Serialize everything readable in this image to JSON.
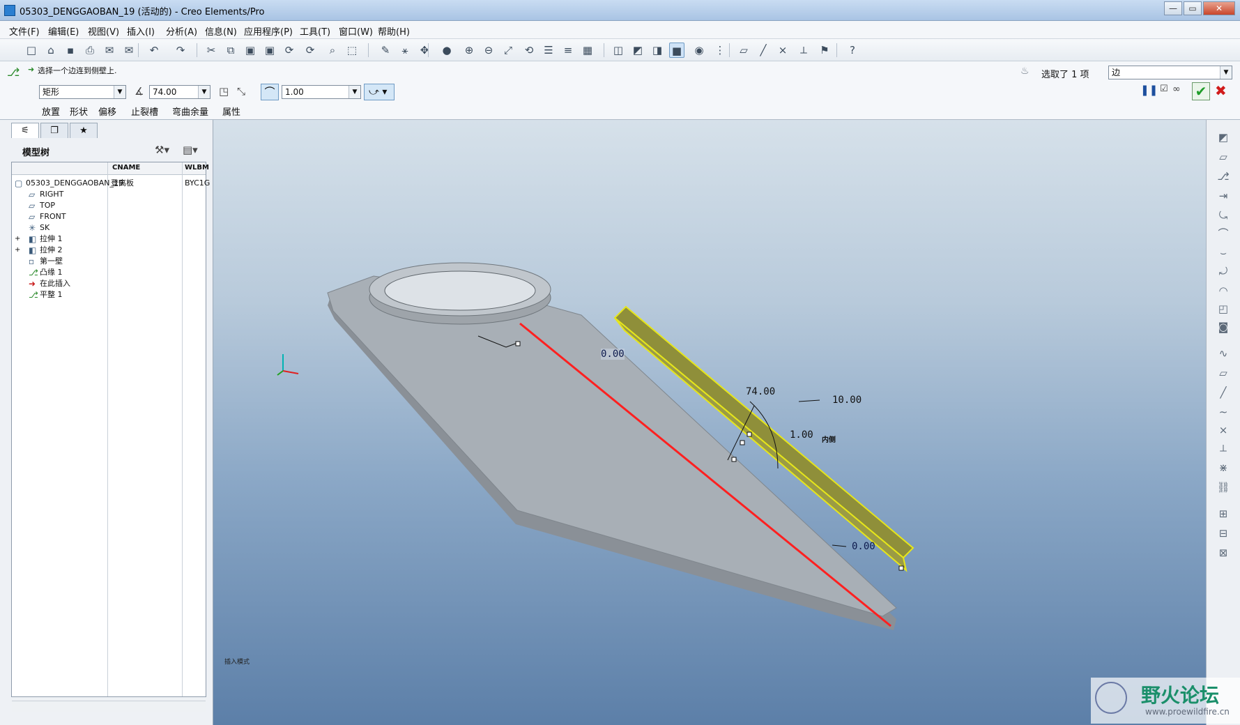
{
  "window": {
    "title": "05303_DENGGAOBAN_19 (活动的) - Creo Elements/Pro",
    "controls": [
      "—",
      "▭",
      "✕"
    ]
  },
  "menu": [
    "文件(F)",
    "编辑(E)",
    "视图(V)",
    "插入(I)",
    "分析(A)",
    "信息(N)",
    "应用程序(P)",
    "工具(T)",
    "窗口(W)",
    "帮助(H)"
  ],
  "toolbar": {
    "icons": [
      "new-icon",
      "open-icon",
      "save-icon",
      "print-icon",
      "email-icon",
      "email-link-icon",
      "undo-icon",
      "redo-icon",
      "cut-icon",
      "copy-icon",
      "paste-icon",
      "paste-special-icon",
      "regenerate-icon",
      "regen-manager-icon",
      "find-icon",
      "select-box-icon",
      "sketch-icon",
      "datum-display-icon",
      "spin-center-icon",
      "appearance-icon",
      "zoom-in-icon",
      "zoom-out-icon",
      "refit-icon",
      "reorient-icon",
      "saved-views-icon",
      "layers-icon",
      "view-manager-icon",
      "wireframe-icon",
      "hidden-line-icon",
      "no-hidden-icon",
      "shading-icon",
      "enhanced-realism-icon",
      "datum-toggle-icon",
      "datum-plane-icon",
      "datum-axis-icon",
      "datum-point-icon",
      "csys-icon",
      "annotation-icon",
      "whats-this-icon"
    ]
  },
  "dashboard": {
    "prompt": "选择一个边连到侧壁上.",
    "selection_count": "选取了 1 项",
    "filter": "边",
    "shape": "矩形",
    "angle": "74.00",
    "radius": "1.00",
    "tabs": [
      "放置",
      "形状",
      "偏移",
      "止裂槽",
      "弯曲余量",
      "属性"
    ]
  },
  "left_panel": {
    "tabs": [
      "model-tree-tab-icon",
      "folder-browser-tab-icon",
      "favorites-tab-icon"
    ],
    "title": "模型树",
    "columns": [
      "",
      "CNAME",
      "WLBM"
    ],
    "rows": [
      {
        "name": "05303_DENGGAOBAN_19",
        "cname": "登高板",
        "wlbm": "BYC1G",
        "icon": "part-icon",
        "indent": 0,
        "expand": ""
      },
      {
        "name": "RIGHT",
        "cname": "",
        "wlbm": "",
        "icon": "datum-plane-icon",
        "indent": 1,
        "expand": ""
      },
      {
        "name": "TOP",
        "cname": "",
        "wlbm": "",
        "icon": "datum-plane-icon",
        "indent": 1,
        "expand": ""
      },
      {
        "name": "FRONT",
        "cname": "",
        "wlbm": "",
        "icon": "datum-plane-icon",
        "indent": 1,
        "expand": ""
      },
      {
        "name": "SK",
        "cname": "",
        "wlbm": "",
        "icon": "csys-icon",
        "indent": 1,
        "expand": ""
      },
      {
        "name": "拉伸 1",
        "cname": "",
        "wlbm": "",
        "icon": "extrude-icon",
        "indent": 1,
        "expand": "+"
      },
      {
        "name": "拉伸 2",
        "cname": "",
        "wlbm": "",
        "icon": "extrude-icon",
        "indent": 1,
        "expand": "+"
      },
      {
        "name": "第一壁",
        "cname": "",
        "wlbm": "",
        "icon": "first-wall-icon",
        "indent": 1,
        "expand": ""
      },
      {
        "name": "凸缘 1",
        "cname": "",
        "wlbm": "",
        "icon": "flange-icon",
        "indent": 1,
        "expand": ""
      },
      {
        "name": "在此插入",
        "cname": "",
        "wlbm": "",
        "icon": "insert-here-icon",
        "indent": 1,
        "expand": ""
      },
      {
        "name": "平整 1",
        "cname": "",
        "wlbm": "",
        "icon": "flat-wall-icon",
        "indent": 1,
        "expand": ""
      }
    ]
  },
  "viewport": {
    "dimensions": {
      "offset_top": "0.00",
      "angle": "74.00",
      "length": "10.00",
      "radius": "1.00",
      "side": "内侧",
      "offset_bottom": "0.00"
    },
    "status": "插入模式",
    "colors": {
      "part": "#a9b0b7",
      "wall": "#8f8f3a",
      "edge": "#ff2020",
      "highlight": "#e6e61a"
    }
  },
  "right_toolbar": {
    "icons": [
      "unattached-wall-icon",
      "flat-wall-icon",
      "flange-wall-icon",
      "extend-wall-icon",
      "twist-wall-icon",
      "bend-icon",
      "unbend-icon",
      "bend-back-icon",
      "edge-bend-icon",
      "corner-relief-icon",
      "form-icon",
      "datum-curve-icon",
      "datum-plane-icon",
      "datum-axis-icon",
      "sketched-curve-icon",
      "datum-point-icon",
      "csys-icon",
      "offset-point-icon",
      "datum-chain-icon",
      "insert-feature-icon",
      "conversion-icon",
      "flatten-icon"
    ]
  },
  "watermark": {
    "title": "野火论坛",
    "url": "www.proewildfire.cn"
  }
}
